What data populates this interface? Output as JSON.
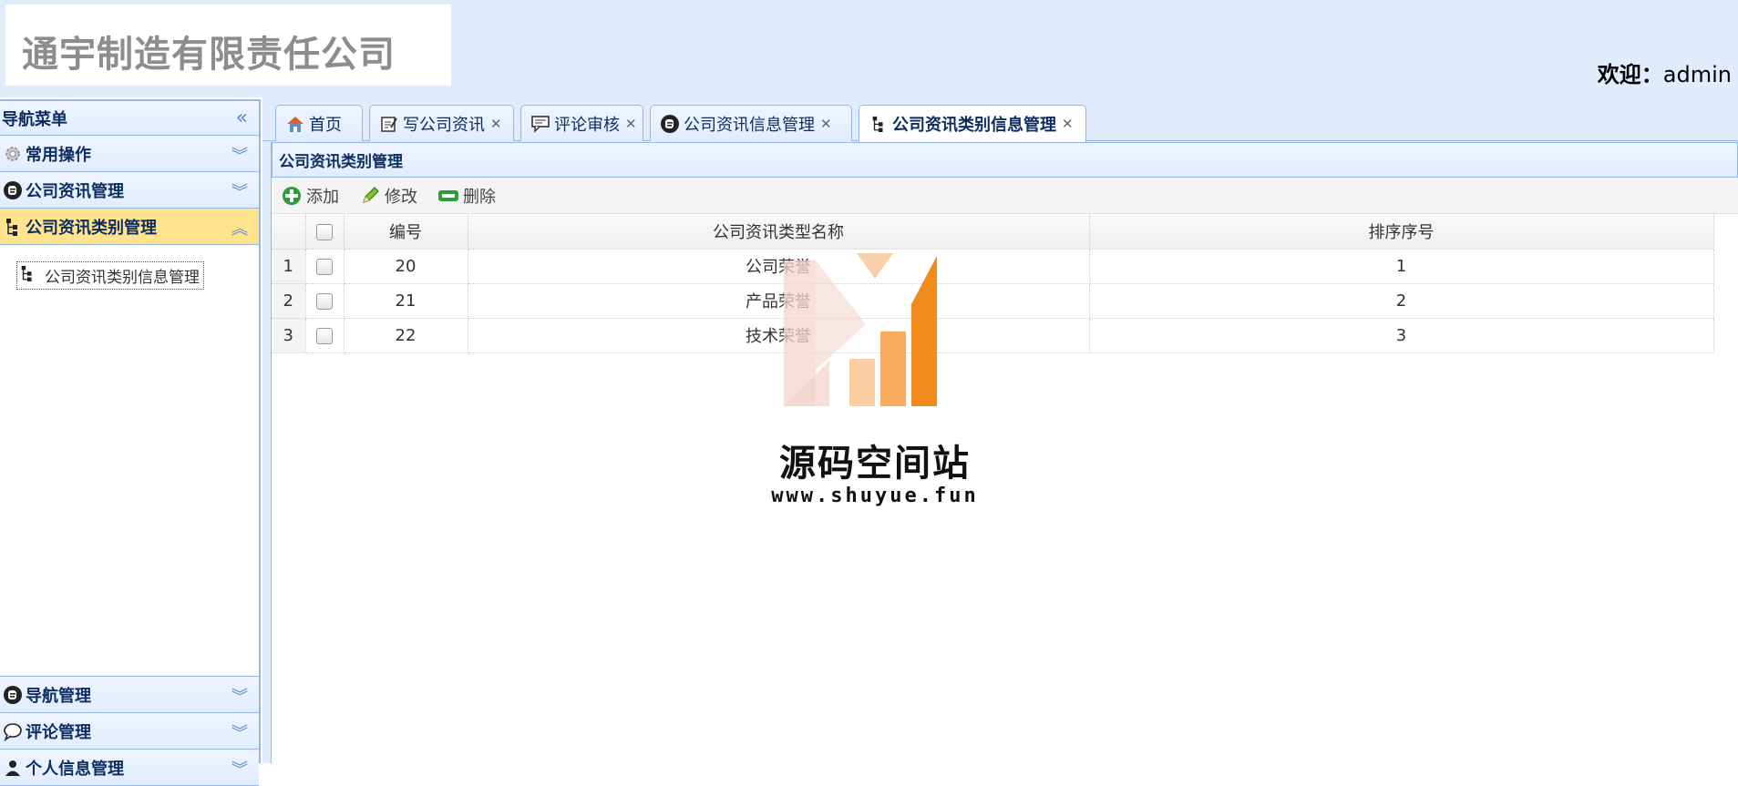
{
  "header": {
    "company_name": "通宇制造有限责任公司",
    "welcome_label": "欢迎：",
    "username": "admin"
  },
  "sidebar": {
    "title": "导航菜单",
    "sections": [
      {
        "label": "常用操作",
        "icon": "gear-icon",
        "expanded": false
      },
      {
        "label": "公司资讯管理",
        "icon": "blogger-icon",
        "expanded": false
      },
      {
        "label": "公司资讯类别管理",
        "icon": "tree-icon",
        "expanded": true
      },
      {
        "label": "导航管理",
        "icon": "blogger-icon",
        "expanded": false
      },
      {
        "label": "评论管理",
        "icon": "speech-bubble-icon",
        "expanded": false
      },
      {
        "label": "个人信息管理",
        "icon": "user-icon",
        "expanded": false
      }
    ],
    "active_items": [
      {
        "label": "公司资讯类别信息管理",
        "icon": "tree-icon"
      }
    ]
  },
  "tabs": [
    {
      "label": "首页",
      "icon": "home-icon",
      "closable": false
    },
    {
      "label": "写公司资讯",
      "icon": "edit-icon",
      "closable": true
    },
    {
      "label": "评论审核",
      "icon": "comment-icon",
      "closable": true
    },
    {
      "label": "公司资讯信息管理",
      "icon": "blogger-icon",
      "closable": true
    },
    {
      "label": "公司资讯类别信息管理",
      "icon": "tree-icon",
      "closable": true,
      "active": true
    }
  ],
  "panel": {
    "title": "公司资讯类别管理",
    "toolbar": {
      "add_label": "添加",
      "edit_label": "修改",
      "delete_label": "删除"
    },
    "table": {
      "columns": [
        "编号",
        "公司资讯类型名称",
        "排序序号"
      ],
      "rows": [
        {
          "row_num": "1",
          "id": "20",
          "name": "公司荣誉",
          "order": "1"
        },
        {
          "row_num": "2",
          "id": "21",
          "name": "产品荣誉",
          "order": "2"
        },
        {
          "row_num": "3",
          "id": "22",
          "name": "技术荣誉",
          "order": "3"
        }
      ]
    }
  },
  "watermark": {
    "name": "源码空间站",
    "url": "www.shuyue.fun"
  },
  "colors": {
    "header_bg": "#e0ecfb",
    "border": "#95b8e7",
    "active_section": "#ffe48d",
    "title_text": "#0e2d5f"
  }
}
